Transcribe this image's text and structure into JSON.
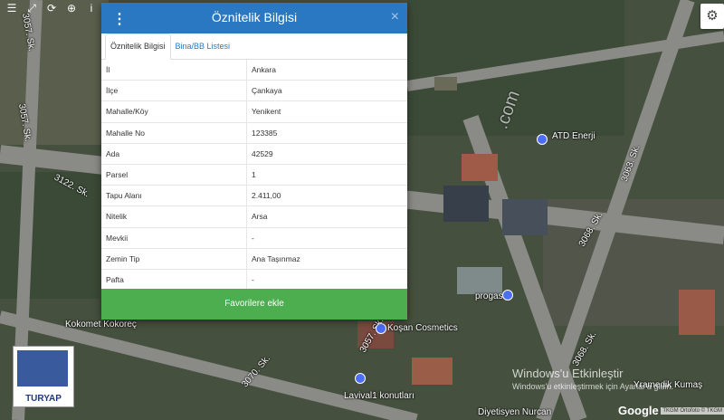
{
  "toolbar": {
    "icons": [
      "menu-icon",
      "expand-icon",
      "refresh-icon",
      "locate-icon",
      "info-icon"
    ],
    "glyphs": [
      "☰",
      "⤢",
      "⟳",
      "⊕",
      "i"
    ]
  },
  "settings_glyph": "⚙",
  "map": {
    "labels": [
      "3122. Sk.",
      "3057. Sk.",
      "3057. Sk.",
      "3063. Sk.",
      "3068. Sk.",
      "3068. Sk.",
      "3070. Sk.",
      "3057. Sk.",
      "ATD Enerji",
      "progas",
      "Koşan Cosmetics",
      "Kokomet Kokoreç",
      "Lavival1 konutları",
      "Diyetisyen Nurcan",
      "Yramedik Kumaş"
    ],
    "watermark_site": ".com"
  },
  "panel": {
    "title": "Öznitelik Bilgisi",
    "menu_glyph": "⋮",
    "close_glyph": "×",
    "tabs": [
      {
        "label": "Öznitelik Bilgisi",
        "active": true
      },
      {
        "label": "Bina/BB Listesi",
        "active": false
      }
    ],
    "rows": [
      {
        "key": "İl",
        "value": "Ankara"
      },
      {
        "key": "İlçe",
        "value": "Çankaya"
      },
      {
        "key": "Mahalle/Köy",
        "value": "Yenikent"
      },
      {
        "key": "Mahalle No",
        "value": "123385"
      },
      {
        "key": "Ada",
        "value": "42529"
      },
      {
        "key": "Parsel",
        "value": "1"
      },
      {
        "key": "Tapu Alanı",
        "value": "2.411,00"
      },
      {
        "key": "Nitelik",
        "value": "Arsa"
      },
      {
        "key": "Mevkii",
        "value": "-"
      },
      {
        "key": "Zemin Tip",
        "value": "Ana Taşınmaz"
      },
      {
        "key": "Pafta",
        "value": "-"
      }
    ],
    "favorite_button": "Favorilere ekle"
  },
  "logo": {
    "text": "TURYAP"
  },
  "windows_watermark": {
    "line1": "Windows'u Etkinleştir",
    "line2": "Windows'u etkinleştirmek için Ayarlar'a gidin."
  },
  "google": "Google",
  "attribution": "TKGM Ortofoto © TKGM"
}
